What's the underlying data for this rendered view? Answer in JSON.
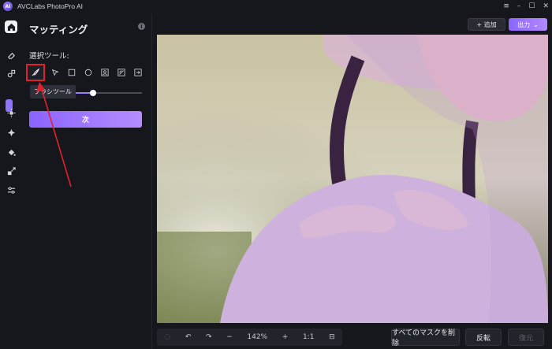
{
  "app": {
    "logo_text": "AI",
    "title": "AVCLabs PhotoPro AI"
  },
  "window_controls": {
    "menu": "≡",
    "minimize": "–",
    "maximize": "☐",
    "close": "✕"
  },
  "rail": {
    "home_icon": "home-icon",
    "items": [
      "eraser-icon",
      "objects-icon",
      "enhance-icon",
      "palette-icon",
      "fill-icon",
      "crop-icon",
      "adjust-icon"
    ]
  },
  "panel": {
    "title": "マッティング",
    "info": "i",
    "select_tool_label": "選択ツール:",
    "tools": [
      "brush-tool-icon",
      "pointer-tool-icon",
      "rectangle-tool-icon",
      "circle-tool-icon",
      "portrait-tool-icon",
      "auto-tool-icon",
      "export-tool-icon"
    ],
    "tooltip": "ブラシツール",
    "size_label_partial": "ズ",
    "next_button": "次"
  },
  "topbar": {
    "add_label": "+ 追加",
    "export_label": "出力",
    "export_caret": "⌄"
  },
  "bottombar": {
    "zoom": "142%",
    "ratio": "1:1",
    "clear_masks": "すべてのマスクを削除",
    "invert": "反転",
    "restore": "復元"
  },
  "colors": {
    "accent": "#9d7cff",
    "highlight_border": "#e0222d",
    "arrow": "#e0222d",
    "mask_overlay": "#c19ad6"
  }
}
